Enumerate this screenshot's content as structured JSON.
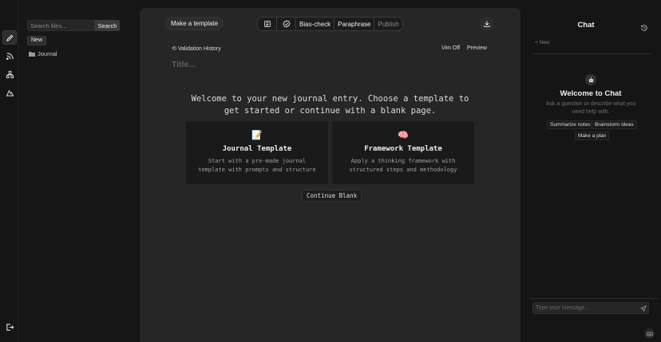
{
  "rail": {
    "items": [
      {
        "icon": "pencil-icon",
        "active": true
      },
      {
        "icon": "rss-icon",
        "active": false
      },
      {
        "icon": "network-icon",
        "active": false
      },
      {
        "icon": "mountain-icon",
        "active": false
      }
    ],
    "bottom_icon": "logout-icon"
  },
  "sidebar": {
    "search_placeholder": "Search files...",
    "search_label": "Search",
    "new_label": "New",
    "folders": [
      {
        "name": "Journal",
        "icon": "folder-icon"
      }
    ]
  },
  "toolbar": {
    "template_label": "Make a template",
    "bias_label": "Bias-check",
    "paraphrase_label": "Paraphrase",
    "publish_label": "Publish",
    "icons": [
      "list-icon",
      "badge-check-icon",
      "download-icon"
    ]
  },
  "editor": {
    "validation_history": "Validation History",
    "vim_label": "Vim Off",
    "preview_label": "Preview",
    "title_placeholder": "Title...",
    "welcome_line1": "Welcome to your new journal entry. Choose a template to",
    "welcome_line2": "get started or continue with a blank page.",
    "cards": [
      {
        "emoji": "📝",
        "title": "Journal Template",
        "desc1": "Start with a pre-made journal",
        "desc2": "template with prompts and structure"
      },
      {
        "emoji": "🧠",
        "title": "Framework Template",
        "desc1": "Apply a thinking framework with",
        "desc2": "structured steps and methodology"
      }
    ],
    "continue_label": "Continue Blank"
  },
  "chat": {
    "title": "Chat",
    "new_label": "+ New",
    "welcome_title": "Welcome to Chat",
    "welcome_desc": "Ask a question or describe what you need help with.",
    "chips": [
      "Summarize notes",
      "Brainstorm ideas",
      "Make a plan"
    ],
    "input_placeholder": "Type your message..."
  }
}
